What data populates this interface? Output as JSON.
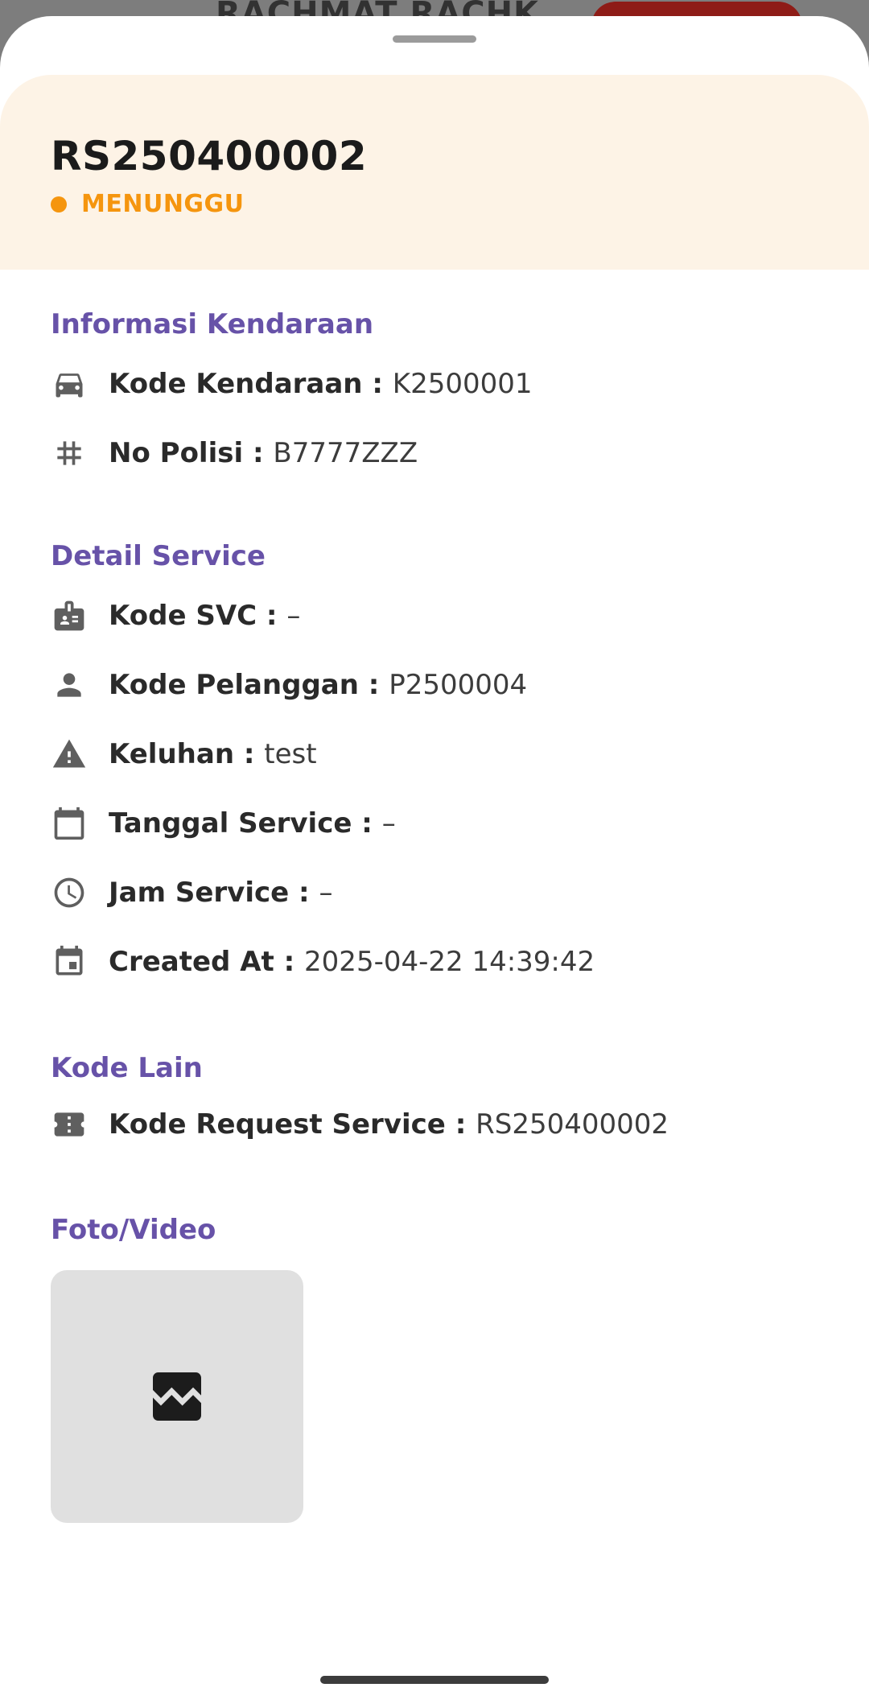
{
  "background_page": {
    "title_partial": "RACHMAT RACHK"
  },
  "header": {
    "request_code": "RS250400002",
    "status": "MENUNGGU",
    "status_color": "#f5950e",
    "background_color": "#fdf3e6"
  },
  "sections": {
    "vehicle": {
      "title": "Informasi Kendaraan",
      "rows": [
        {
          "icon": "car-icon",
          "label": "Kode Kendaraan : ",
          "value": "K2500001"
        },
        {
          "icon": "hash-icon",
          "label": "No Polisi : ",
          "value": "B7777ZZZ"
        }
      ]
    },
    "service": {
      "title": "Detail Service",
      "rows": [
        {
          "icon": "badge-icon",
          "label": "Kode SVC : ",
          "value": "–"
        },
        {
          "icon": "person-icon",
          "label": "Kode Pelanggan : ",
          "value": "P2500004"
        },
        {
          "icon": "warning-icon",
          "label": "Keluhan : ",
          "value": "test"
        },
        {
          "icon": "calendar-icon",
          "label": "Tanggal Service : ",
          "value": "–"
        },
        {
          "icon": "clock-icon",
          "label": "Jam Service : ",
          "value": "–"
        },
        {
          "icon": "event-icon",
          "label": "Created At : ",
          "value": "2025-04-22 14:39:42"
        }
      ]
    },
    "other_codes": {
      "title": "Kode Lain",
      "rows": [
        {
          "icon": "ticket-icon",
          "label": "Kode Request Service : ",
          "value": "RS250400002"
        }
      ]
    },
    "media": {
      "title": "Foto/Video",
      "items": [
        {
          "icon": "broken-image-icon"
        }
      ]
    }
  },
  "accent_color": "#6752a8"
}
